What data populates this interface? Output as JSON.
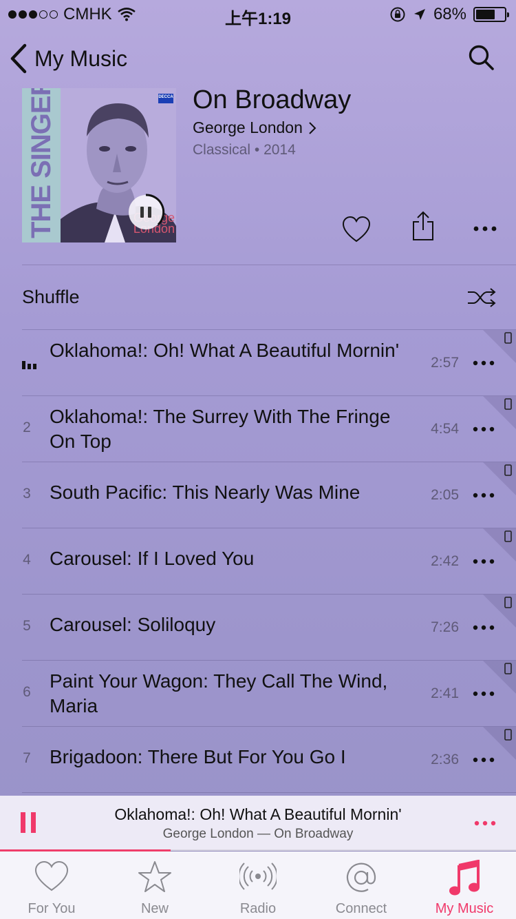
{
  "status_bar": {
    "carrier": "CMHK",
    "time": "上午1:19",
    "battery": "68%",
    "battery_level": 0.68,
    "signal_bars_filled": 3,
    "signal_bars_total": 5
  },
  "nav": {
    "back_label": "My Music"
  },
  "album": {
    "title": "On Broadway",
    "artist": "George London",
    "genre": "Classical",
    "year": "2014",
    "cover_text_vertical": "THE SINGERS",
    "cover_text_name": "George London",
    "cover_label": "DECCA"
  },
  "shuffle_label": "Shuffle",
  "tracks": [
    {
      "num": "",
      "title": "Oklahoma!: Oh! What A Beautiful Mornin'",
      "duration": "2:57",
      "now_playing": true
    },
    {
      "num": "2",
      "title": "Oklahoma!: The Surrey With The Fringe On Top",
      "duration": "4:54"
    },
    {
      "num": "3",
      "title": "South Pacific: This Nearly Was Mine",
      "duration": "2:05"
    },
    {
      "num": "4",
      "title": "Carousel: If I Loved You",
      "duration": "2:42"
    },
    {
      "num": "5",
      "title": "Carousel: Soliloquy",
      "duration": "7:26"
    },
    {
      "num": "6",
      "title": "Paint Your Wagon: They Call The Wind, Maria",
      "duration": "2:41"
    },
    {
      "num": "7",
      "title": "Brigadoon: There But For You Go I",
      "duration": "2:36"
    }
  ],
  "mini_player": {
    "song": "Oklahoma!: Oh! What A Beautiful Mornin'",
    "subtitle": "George London — On Broadway",
    "progress": 0.33
  },
  "tabs": [
    {
      "label": "For You",
      "icon": "heart-icon"
    },
    {
      "label": "New",
      "icon": "star-icon"
    },
    {
      "label": "Radio",
      "icon": "radio-icon"
    },
    {
      "label": "Connect",
      "icon": "at-icon"
    },
    {
      "label": "My Music",
      "icon": "music-note-icon",
      "active": true
    }
  ],
  "colors": {
    "accent": "#f0396a",
    "background_top": "#b6a9dd",
    "background_bottom": "#9892c8",
    "secondary_text": "#5f5a78"
  }
}
